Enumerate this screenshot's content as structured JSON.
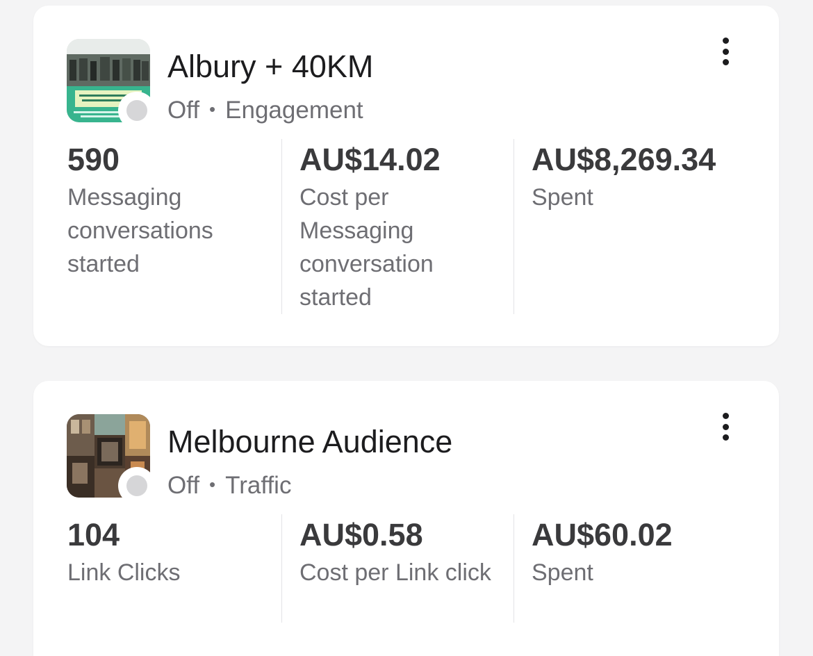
{
  "campaigns": [
    {
      "title": "Albury + 40KM",
      "status": "Off",
      "separator": "•",
      "objective": "Engagement",
      "metrics": [
        {
          "value": "590",
          "label": "Messaging conversations started"
        },
        {
          "value": "AU$14.02",
          "label": "Cost per Messaging conversation started"
        },
        {
          "value": "AU$8,269.34",
          "label": "Spent"
        }
      ]
    },
    {
      "title": "Melbourne Audience",
      "status": "Off",
      "separator": "•",
      "objective": "Traffic",
      "metrics": [
        {
          "value": "104",
          "label": "Link Clicks"
        },
        {
          "value": "AU$0.58",
          "label": "Cost per Link click"
        },
        {
          "value": "AU$60.02",
          "label": "Spent"
        }
      ]
    }
  ],
  "icons": {
    "more": "more-vertical-icon",
    "status": "status-dot-icon"
  },
  "colors": {
    "status_off": "#d6d6d8",
    "card_bg": "#ffffff",
    "page_bg": "#f4f4f5"
  }
}
